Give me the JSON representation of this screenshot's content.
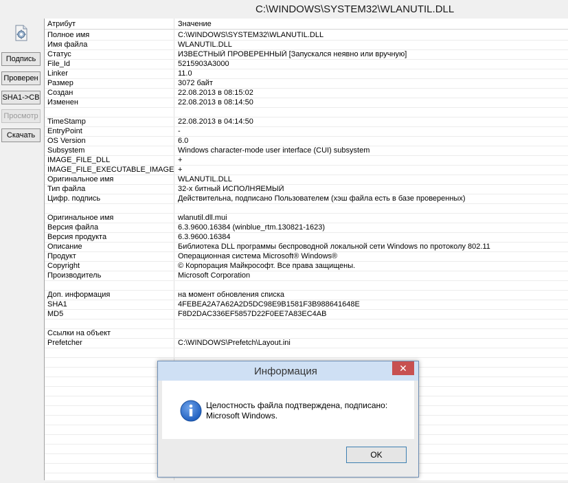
{
  "window": {
    "title": "C:\\WINDOWS\\SYSTEM32\\WLANUTIL.DLL"
  },
  "toolbar": {
    "icon": "file-settings-icon",
    "buttons": [
      {
        "label": "Подпись",
        "enabled": true
      },
      {
        "label": "Проверен",
        "enabled": true
      },
      {
        "label": "SHA1->CB",
        "enabled": true
      },
      {
        "label": "Просмотр",
        "enabled": false
      },
      {
        "label": "Скачать",
        "enabled": true
      }
    ]
  },
  "grid": {
    "columns": {
      "attribute": "Атрибут",
      "value": "Значение"
    },
    "rows": [
      {
        "attr": "Полное имя",
        "value": "C:\\WINDOWS\\SYSTEM32\\WLANUTIL.DLL"
      },
      {
        "attr": "Имя файла",
        "value": "WLANUTIL.DLL"
      },
      {
        "attr": "Статус",
        "value": "ИЗВЕСТНЫЙ ПРОВЕРЕННЫЙ [Запускался неявно или вручную]"
      },
      {
        "attr": "File_Id",
        "value": "5215903A3000"
      },
      {
        "attr": "Linker",
        "value": "11.0"
      },
      {
        "attr": "Размер",
        "value": "3072 байт"
      },
      {
        "attr": "Создан",
        "value": "22.08.2013 в 08:15:02"
      },
      {
        "attr": "Изменен",
        "value": "22.08.2013 в 08:14:50"
      },
      {
        "attr": "",
        "value": ""
      },
      {
        "attr": "TimeStamp",
        "value": "22.08.2013 в 04:14:50"
      },
      {
        "attr": "EntryPoint",
        "value": "-"
      },
      {
        "attr": "OS Version",
        "value": "6.0"
      },
      {
        "attr": "Subsystem",
        "value": "Windows character-mode user interface (CUI) subsystem"
      },
      {
        "attr": "IMAGE_FILE_DLL",
        "value": "+"
      },
      {
        "attr": "IMAGE_FILE_EXECUTABLE_IMAGE",
        "value": "+"
      },
      {
        "attr": "Оригинальное имя",
        "value": "WLANUTIL.DLL"
      },
      {
        "attr": "Тип файла",
        "value": "32-х битный ИСПОЛНЯЕМЫЙ"
      },
      {
        "attr": "Цифр. подпись",
        "value": "Действительна, подписано Пользователем (хэш файла есть в базе проверенных)"
      },
      {
        "attr": "",
        "value": ""
      },
      {
        "attr": "Оригинальное имя",
        "value": "wlanutil.dll.mui"
      },
      {
        "attr": "Версия файла",
        "value": "6.3.9600.16384 (winblue_rtm.130821-1623)"
      },
      {
        "attr": "Версия продукта",
        "value": "6.3.9600.16384"
      },
      {
        "attr": "Описание",
        "value": "Библиотека DLL программы беспроводной локальной сети Windows по протоколу 802.11"
      },
      {
        "attr": "Продукт",
        "value": "Операционная система Microsoft® Windows®"
      },
      {
        "attr": "Copyright",
        "value": "© Корпорация Майкрософт. Все права защищены."
      },
      {
        "attr": "Производитель",
        "value": "Microsoft Corporation"
      },
      {
        "attr": "",
        "value": ""
      },
      {
        "attr": "Доп. информация",
        "value": "на момент обновления списка"
      },
      {
        "attr": "SHA1",
        "value": "4FEBEA2A7A62A2D5DC98E9B1581F3B988641648E"
      },
      {
        "attr": "MD5",
        "value": "F8D2DAC336EF5857D22F0EE7A83EC4AB"
      },
      {
        "attr": "",
        "value": ""
      },
      {
        "attr": "Ссылки на объект",
        "value": ""
      },
      {
        "attr": "Prefetcher",
        "value": "C:\\WINDOWS\\Prefetch\\Layout.ini"
      }
    ]
  },
  "dialog": {
    "title": "Информация",
    "close_label": "✕",
    "icon": "info-icon",
    "message_line1": "Целостность файла подтверждена, подписано:",
    "message_line2": "Microsoft Windows.",
    "ok_label": "OK"
  },
  "colors": {
    "dialog_titlebar": "#cfe0f4",
    "close_button": "#c75050",
    "info_icon": "#1f5fbf"
  }
}
